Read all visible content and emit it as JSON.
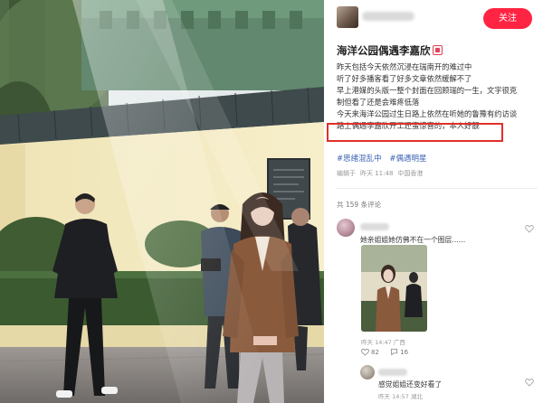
{
  "post": {
    "follow_label": "关注",
    "title": "海洋公园偶遇李嘉欣",
    "title_emoji": "red-calendar-emoji",
    "body_lines": [
      "昨天包括今天依然沉浸在瑞南开的难过中",
      "听了好多播客看了好多文章依然缓解不了",
      "早上港媒的头版一整个封面在回顾瑞的一生，文字很克",
      "制但看了还是会难疼低落",
      "今天来海洋公园过生日路上依然在听她的鲁豫有约访谈",
      "路上偶遇李嘉欣开工还蛮惊喜的，本人好靓"
    ],
    "tags": [
      "#思绪混乱中",
      "#偶遇明星"
    ],
    "meta": {
      "edited": "编辑于",
      "time": "昨天 11:48",
      "location": "中国香港"
    },
    "comment_count": "共 159 条评论"
  },
  "comments": [
    {
      "text": "她亲姐姐她仿佛不在一个图层......",
      "meta": "昨天 14:47 广西",
      "likes": "82",
      "replies": "16"
    },
    {
      "text": "感觉姐姐还变好看了",
      "meta": "昨天 14:57 湖北"
    }
  ],
  "colors": {
    "accent": "#ff2442",
    "highlight_box": "#e0302a",
    "tag": "#3a62b5"
  },
  "icons": {
    "share": "share-icon",
    "heart": "heart-icon",
    "like": "thumb-icon",
    "reply": "reply-icon"
  }
}
